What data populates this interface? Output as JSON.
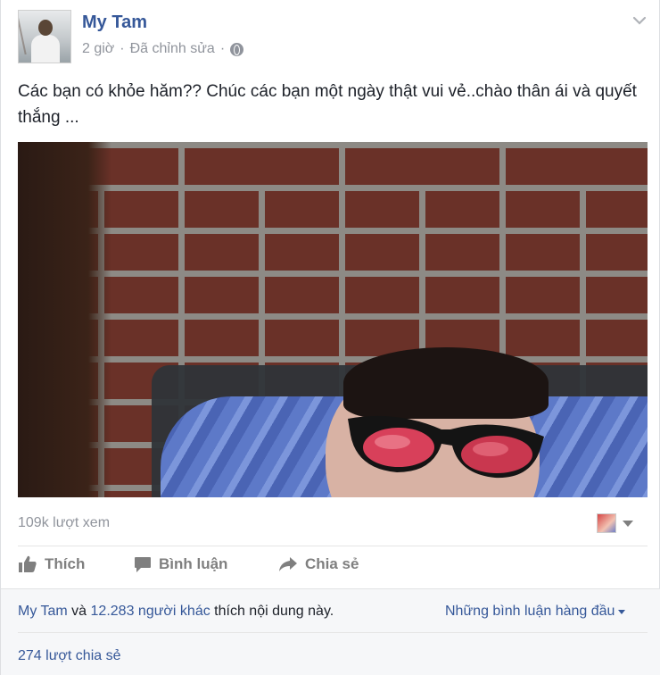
{
  "post": {
    "author": "My Tam",
    "time": "2 giờ",
    "separator": "·",
    "edited": "Đã chỉnh sửa",
    "privacy_icon": "globe-icon",
    "menu_icon": "chevron-down-icon",
    "text": "Các bạn có khỏe hăm?? Chúc các bạn một ngày thật vui vẻ..chào thân ái và quyết thắng ..."
  },
  "video": {
    "views": "109k lượt xem"
  },
  "actions": {
    "like": "Thích",
    "comment": "Bình luận",
    "share": "Chia sẻ"
  },
  "footer": {
    "liker_name": "My Tam",
    "and_word": "và",
    "others_link": "12.283 người khác",
    "likes_suffix": "thích nội dung này.",
    "top_comments": "Những bình luận hàng đầu",
    "shares": "274 lượt chia sẻ"
  },
  "colors": {
    "link": "#365899",
    "muted": "#90949c",
    "action_grey": "#7f7f7f",
    "footer_bg": "#f6f7f9"
  }
}
